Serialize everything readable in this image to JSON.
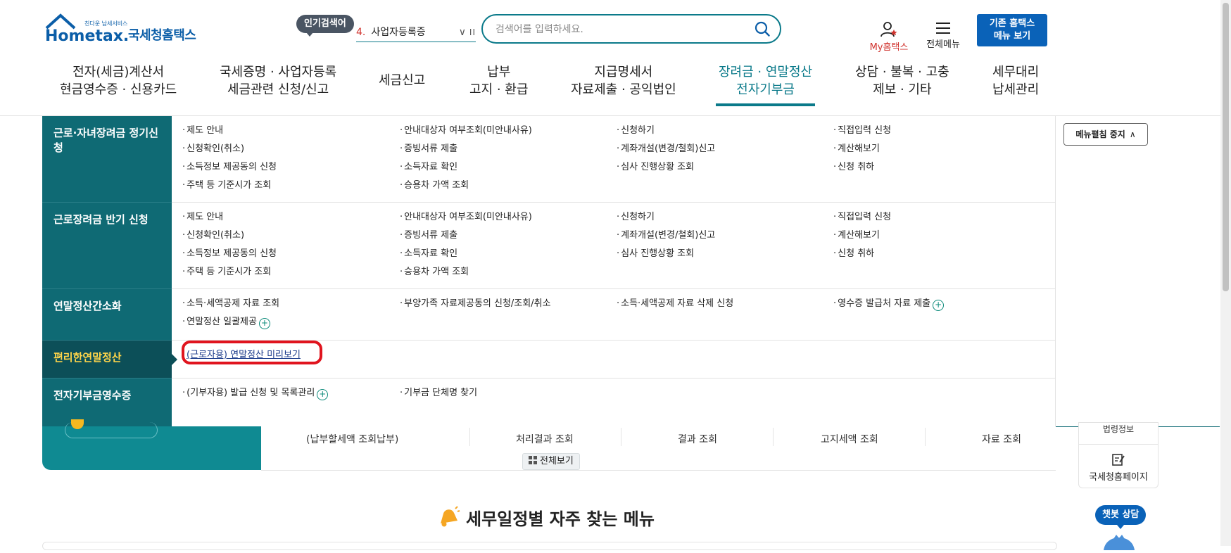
{
  "header": {
    "logo_text": "Hometax.",
    "logo_small": "친다운 납세서비스",
    "logo_kr": "국세청홈택스",
    "popular_badge": "인기검색어",
    "popular_rank": "4.",
    "popular_term": "사업자등록증",
    "search_placeholder": "검색어를 입력하세요.",
    "my_label": "My홈택스",
    "allmenu_label": "전체메뉴",
    "old_home_line1": "기존 홈택스",
    "old_home_line2": "메뉴 보기"
  },
  "gnb": [
    {
      "line1": "전자(세금)계산서",
      "line2": "현금영수증 · 신용카드"
    },
    {
      "line1": "국세증명 · 사업자등록",
      "line2": "세금관련 신청/신고"
    },
    {
      "line1": "세금신고",
      "line2": ""
    },
    {
      "line1": "납부",
      "line2": "고지 · 환급"
    },
    {
      "line1": "지급명세서",
      "line2": "자료제출 · 공익법인"
    },
    {
      "line1": "장려금 · 연말정산",
      "line2": "전자기부금"
    },
    {
      "line1": "상담 · 불복 · 고충",
      "line2": "제보 · 기타"
    },
    {
      "line1": "세무대리",
      "line2": "납세관리"
    }
  ],
  "mega_menu": {
    "rows": [
      {
        "title": "근로·자녀장려금 정기신청",
        "links": [
          "제도 안내",
          "안내대상자 여부조회(미안내사유)",
          "신청하기",
          "직접입력 신청",
          "신청확인(취소)",
          "증빙서류 제출",
          "계좌개설(변경/철회)신고",
          "계산해보기",
          "소득정보 제공동의 신청",
          "소득자료 확인",
          "심사 진행상황 조회",
          "신청 취하",
          "주택 등 기준시가 조회",
          "승용차 가액 조회"
        ]
      },
      {
        "title": "근로장려금 반기 신청",
        "links": [
          "제도 안내",
          "안내대상자 여부조회(미안내사유)",
          "신청하기",
          "직접입력 신청",
          "신청확인(취소)",
          "증빙서류 제출",
          "계좌개설(변경/철회)신고",
          "계산해보기",
          "소득정보 제공동의 신청",
          "소득자료 확인",
          "심사 진행상황 조회",
          "신청 취하",
          "주택 등 기준시가 조회",
          "승용차 가액 조회"
        ]
      },
      {
        "title": "연말정산간소화",
        "links": [
          "소득·세액공제 자료 조회",
          "부양가족 자료제공동의 신청/조회/취소",
          "소득·세액공제 자료 삭제 신청",
          "영수증 발급처 자료 제출",
          "연말정산 일괄제공"
        ]
      },
      {
        "title": "편리한연말정산",
        "links": [
          "(근로자용) 연말정산 미리보기"
        ]
      },
      {
        "title": "전자기부금영수증",
        "links": [
          "(기부자용) 발급 신청 및 목록관리",
          "기부금 단체명 찾기"
        ]
      }
    ],
    "fold_button": "메뉴펼침 중지"
  },
  "quick": {
    "items": [
      "(납부할세액 조회납부)",
      "처리결과 조회",
      "결과 조회",
      "고지세액 조회",
      "자료 조회"
    ],
    "view_all": "전체보기"
  },
  "side_widget": {
    "top_label": "법령정보",
    "bottom_label": "국세청홈페이지"
  },
  "section_title": "세무일정별 자주 찾는 메뉴",
  "chatbot_label": "챗봇 상담",
  "colors": {
    "teal": "#0f6a74",
    "active_teal": "#0b7a8a",
    "highlight": "#e0141e",
    "brand_blue": "#0a62b8",
    "active_row_text": "#ffd54a"
  }
}
